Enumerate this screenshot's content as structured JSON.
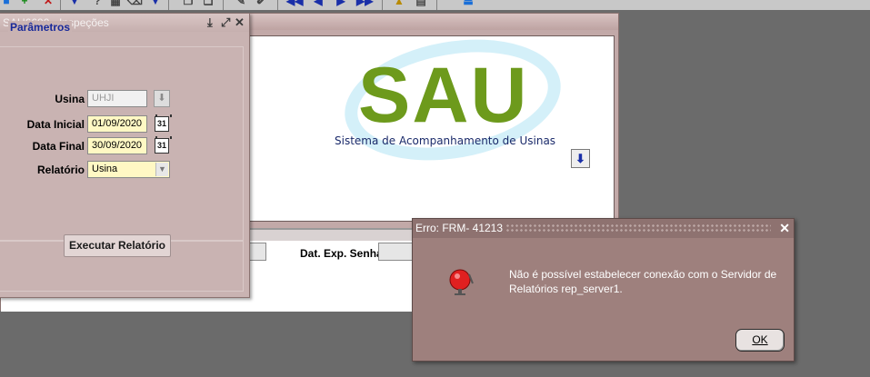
{
  "toolbar": {
    "icons": [
      "add-icon",
      "delete-icon",
      "down-arrow-icon",
      "help-icon",
      "grid-icon",
      "clear-icon",
      "down-icon",
      "copy-icon",
      "paste-icon",
      "edit-icon",
      "pen-icon",
      "first-icon",
      "prev-icon",
      "next-icon",
      "last-icon",
      "upload-icon",
      "print-icon",
      "exit-icon"
    ]
  },
  "param_window": {
    "title": "SAU6690 - Inspeções",
    "group_title": "Parâmetros",
    "usina_label": "Usina",
    "usina_value": "UHJI",
    "data_inicial_label": "Data Inicial",
    "data_inicial_value": "01/09/2020",
    "data_final_label": "Data Final",
    "data_final_value": "30/09/2020",
    "relatorio_label": "Relatório",
    "relatorio_value": "Usina",
    "calendar_glyph": "31",
    "run_button": "Executar Relatório"
  },
  "main_window": {
    "logo_text": "SAU",
    "logo_subtitle": "Sistema de Acompanhamento de Usinas",
    "dat_exp_label": "Dat. Exp. Senha"
  },
  "error_dialog": {
    "title": "Erro: FRM- 41213",
    "message": "Não é possível estabelecer conexão com o Servidor de Relatórios rep_server1.",
    "ok_label": "OK",
    "close_glyph": "✕"
  },
  "colors": {
    "logo_green": "#6d9a1c",
    "dialog_bg": "#9e807d",
    "accent_blue": "#18299a"
  }
}
